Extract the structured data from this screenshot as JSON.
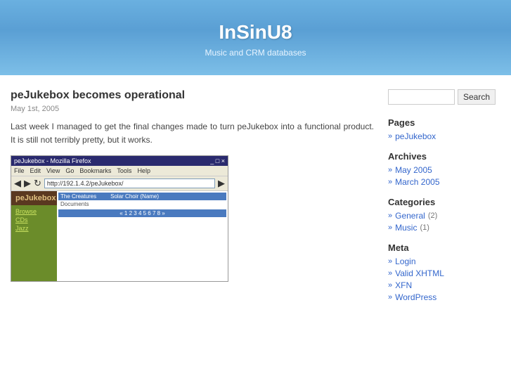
{
  "header": {
    "title": "InSinU8",
    "subtitle": "Music and CRM databases"
  },
  "search": {
    "placeholder": "",
    "button_label": "Search"
  },
  "post": {
    "title": "peJukebox becomes operational",
    "date": "May 1st, 2005",
    "content": "Last week I managed to get the final changes made to turn peJukebox into a functional product. It is still not terribly pretty, but it works.",
    "screenshot": {
      "titlebar": "peJukebox - Mozilla Firefox",
      "address": "http://192.1.4.2/peJukebox/",
      "app_name": "peJukebox",
      "nav_items": [
        "Browse",
        "CDs",
        "Jazz"
      ],
      "column1": "The Creatures",
      "column2": "Solar Choir (Name)",
      "subtext": "Documents"
    }
  },
  "sidebar": {
    "pages": {
      "title": "Pages",
      "items": [
        {
          "label": "peJukebox",
          "href": "#"
        }
      ]
    },
    "archives": {
      "title": "Archives",
      "items": [
        {
          "label": "May 2005",
          "href": "#"
        },
        {
          "label": "March 2005",
          "href": "#"
        }
      ]
    },
    "categories": {
      "title": "Categories",
      "items": [
        {
          "label": "General",
          "count": "(2)",
          "href": "#"
        },
        {
          "label": "Music",
          "count": "(1)",
          "href": "#"
        }
      ]
    },
    "meta": {
      "title": "Meta",
      "items": [
        {
          "label": "Login",
          "href": "#"
        },
        {
          "label": "Valid XHTML",
          "href": "#"
        },
        {
          "label": "XFN",
          "href": "#"
        },
        {
          "label": "WordPress",
          "href": "#"
        }
      ]
    }
  }
}
